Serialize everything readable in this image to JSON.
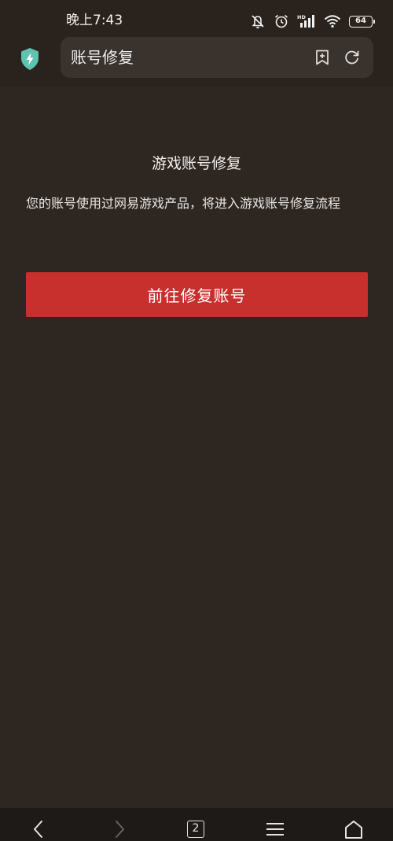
{
  "status_bar": {
    "time": "晚上7:43",
    "battery": "64",
    "icons": [
      "mute-icon",
      "alarm-icon",
      "hd-signal-icon",
      "cell-signal-icon",
      "wifi-icon",
      "battery-icon"
    ],
    "icon_label_hd": "HD"
  },
  "browser": {
    "shield_icon": "shield-bolt-icon",
    "url_text": "账号修复",
    "accent_color": "#5fc3b0"
  },
  "page": {
    "title": "游戏账号修复",
    "description": "您的账号使用过网易游戏产品，将进入游戏账号修复流程",
    "button_label": "前往修复账号",
    "button_color": "#c7302c",
    "background_color": "#2e2620"
  },
  "bottom_nav": {
    "tab_count": "2",
    "items": [
      "back-icon",
      "forward-icon",
      "tabs-icon",
      "menu-icon",
      "home-icon"
    ]
  }
}
